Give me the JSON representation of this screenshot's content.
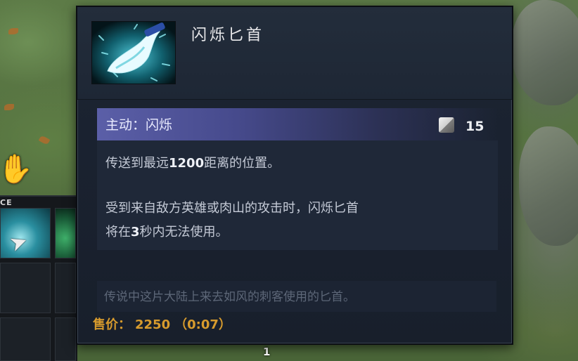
{
  "tooltip": {
    "item_name": "闪烁匕首",
    "item_icon": "blink-dagger-icon",
    "ability": {
      "title": "主动：闪烁",
      "cooldown": "15",
      "cooldown_icon": "cooldown-icon"
    },
    "description": {
      "line1_a": "传送到最远",
      "line1_b": "1200",
      "line1_c": "距离的位置。",
      "line2": "受到来自敌方英雄或肉山的攻击时，闪烁匕首",
      "line3_a": "将在",
      "line3_b": "3",
      "line3_c": "秒内无法使用。"
    },
    "lore": "传说中这片大陆上来去如风的刺客使用的匕首。",
    "sell": {
      "label": "售价：",
      "price": "2250",
      "time": "（0:07）"
    }
  },
  "hud": {
    "inventory_label": "CE",
    "bottom_count": "1"
  },
  "colors": {
    "ability_bar": "#5b5fa8",
    "sell_text": "#d79b2d",
    "tooltip_bg": "#1a2230"
  }
}
